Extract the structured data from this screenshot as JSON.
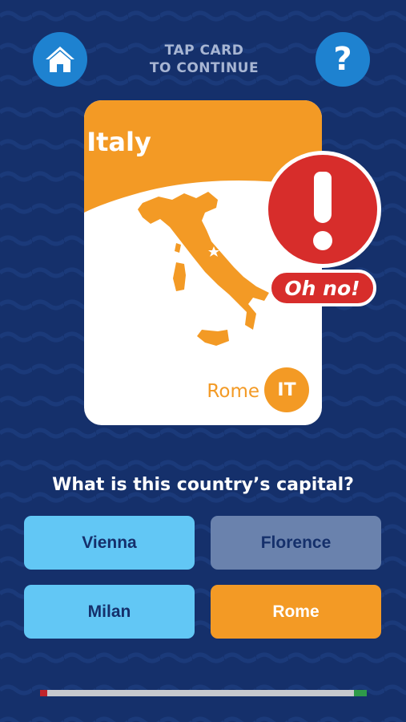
{
  "header": {
    "home_icon": "home-icon",
    "help_icon": "question-mark-icon",
    "help_glyph": "?",
    "tap_hint_line1": "TAP CARD",
    "tap_hint_line2": "TO CONTINUE"
  },
  "card": {
    "country": "Italy",
    "capital": "Rome",
    "code": "IT",
    "map_icon": "italy-map",
    "capital_marker_icon": "star-icon"
  },
  "feedback": {
    "icon": "exclamation-icon",
    "message": "Oh no!"
  },
  "question": "What is this country’s capital?",
  "answers": [
    {
      "label": "Vienna",
      "state": "default"
    },
    {
      "label": "Florence",
      "state": "selected-wrong"
    },
    {
      "label": "Milan",
      "state": "default"
    },
    {
      "label": "Rome",
      "state": "correct"
    }
  ],
  "progress": {
    "fraction": 0.96
  },
  "colors": {
    "background": "#15306b",
    "header_button": "#1e82d0",
    "card_accent": "#f39a25",
    "alert_red": "#d72d2b",
    "answer_default": "#62c7f5",
    "answer_default_text": "#15306b",
    "answer_wrong": "#6a82ad",
    "answer_wrong_text": "#15306b",
    "answer_correct": "#f39a25",
    "answer_correct_text": "#ffffff",
    "progress_start": "#c0242b",
    "progress_end": "#2e9a4a"
  }
}
